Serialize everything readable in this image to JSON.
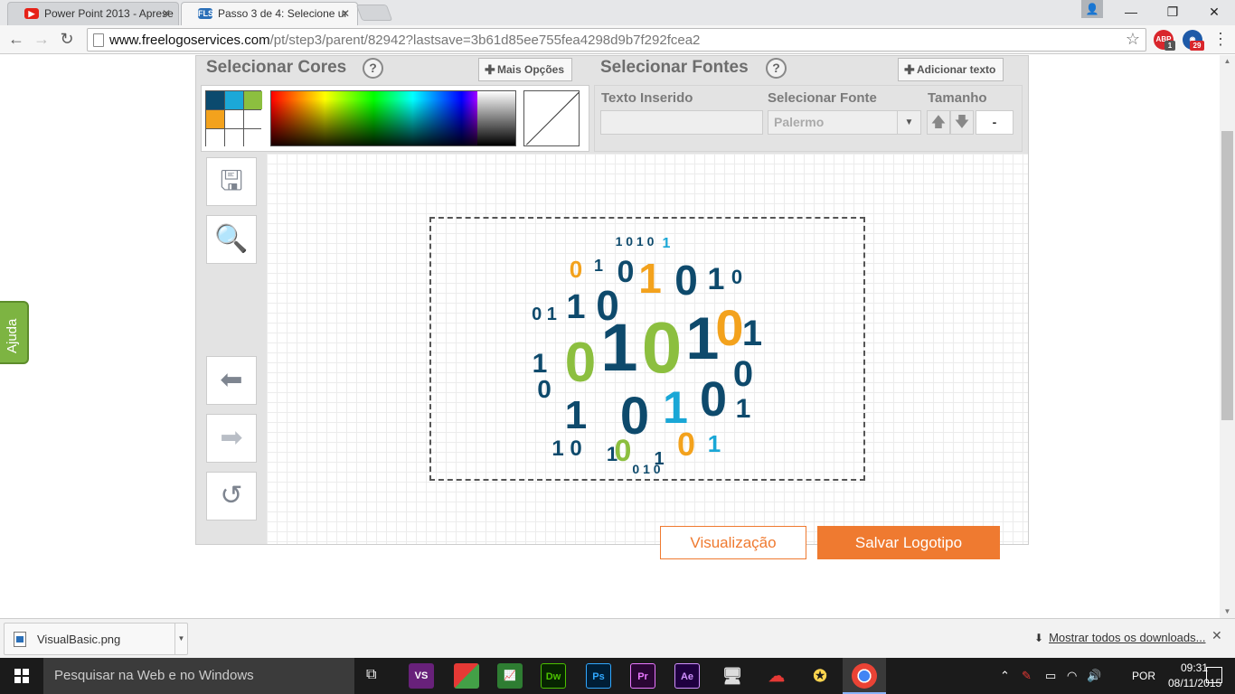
{
  "browser": {
    "tabs": [
      {
        "title": "Power Point 2013 - Aprese",
        "favicon": "youtube-icon",
        "active": false
      },
      {
        "title": "Passo 3 de 4: Selecione ur",
        "favicon_text": "FLS",
        "active": true
      }
    ],
    "url_host": "www.freelogoservices.com",
    "url_path": "/pt/step3/parent/82942?lastsave=3b61d85ee755fea4298d9b7f292fcea2",
    "ext_abp_label": "ABP",
    "ext_abp_badge": "1",
    "ext_2_badge": "29"
  },
  "help_tab": {
    "label": "Ajuda"
  },
  "colors_panel": {
    "title": "Selecionar Cores",
    "help": "?",
    "more_button": "Mais Opções",
    "swatches": [
      "#0b4a6e",
      "#1ba8d8",
      "#8cbf3f",
      "#f3a21d",
      "#ffffff",
      "#ffffff",
      "#ffffff",
      "#ffffff",
      "#ffffff"
    ]
  },
  "fonts_panel": {
    "title": "Selecionar Fontes",
    "help": "?",
    "add_text_button": "Adicionar texto",
    "col_text": "Texto Inserido",
    "col_font": "Selecionar Fonte",
    "col_size": "Tamanho",
    "text_value": "",
    "font_value": "Palermo",
    "size_value": "-"
  },
  "tools": [
    {
      "name": "save-icon",
      "glyph": "💾"
    },
    {
      "name": "zoom-icon",
      "glyph": "🔍"
    },
    {
      "name": "undo-arrow-icon",
      "glyph": "⬅"
    },
    {
      "name": "redo-arrow-icon",
      "glyph": "➡"
    },
    {
      "name": "reset-icon",
      "glyph": "↺"
    }
  ],
  "actions": {
    "preview": "Visualização",
    "save": "Salvar Logotipo"
  },
  "download_bar": {
    "file_name": "VisualBasic.png",
    "show_all": "Mostrar todos os downloads..."
  },
  "taskbar": {
    "search_placeholder": "Pesquisar na Web e no Windows",
    "apps": [
      {
        "label": "VS",
        "color": "#68217a"
      },
      {
        "label": "",
        "color": "#e5a00d"
      },
      {
        "label": "",
        "color": "#2e7d32"
      },
      {
        "label": "Dw",
        "color": "#4cc200"
      },
      {
        "label": "Ps",
        "color": "#31a8ff"
      },
      {
        "label": "Pr",
        "color": "#ea77ff"
      },
      {
        "label": "Ae",
        "color": "#d291ff"
      },
      {
        "label": "",
        "color": "#9e9e9e"
      },
      {
        "label": "",
        "color": "#e53935"
      },
      {
        "label": "",
        "color": "#ffd54f"
      },
      {
        "label": "",
        "color": "#4285f4"
      }
    ],
    "language": "POR",
    "time": "09:31",
    "date": "08/11/2015"
  },
  "logo": {
    "colors": {
      "dark": "#0e4a6c",
      "cyan": "#1aa7d6",
      "green": "#8cbf3f",
      "orange": "#f3a21d"
    }
  }
}
